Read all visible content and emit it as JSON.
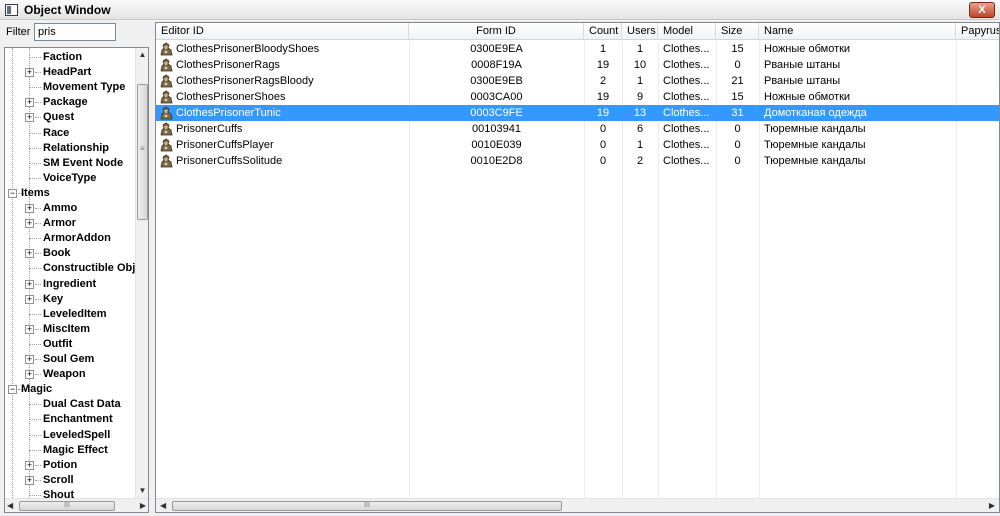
{
  "window": {
    "title": "Object Window",
    "close_label": "X"
  },
  "filter": {
    "label": "Filter",
    "value": "pris"
  },
  "tree": {
    "items": [
      {
        "label": "Faction",
        "expander": ""
      },
      {
        "label": "HeadPart",
        "expander": "+"
      },
      {
        "label": "Movement Type",
        "expander": ""
      },
      {
        "label": "Package",
        "expander": "+"
      },
      {
        "label": "Quest",
        "expander": "+"
      },
      {
        "label": "Race",
        "expander": ""
      },
      {
        "label": "Relationship",
        "expander": ""
      },
      {
        "label": "SM Event Node",
        "expander": ""
      },
      {
        "label": "VoiceType",
        "expander": ""
      },
      {
        "label": "Items",
        "expander": "−"
      },
      {
        "label": "Ammo",
        "expander": "+"
      },
      {
        "label": "Armor",
        "expander": "+"
      },
      {
        "label": "ArmorAddon",
        "expander": ""
      },
      {
        "label": "Book",
        "expander": "+"
      },
      {
        "label": "Constructible Obj",
        "expander": ""
      },
      {
        "label": "Ingredient",
        "expander": "+"
      },
      {
        "label": "Key",
        "expander": "+"
      },
      {
        "label": "LeveledItem",
        "expander": ""
      },
      {
        "label": "MiscItem",
        "expander": "+"
      },
      {
        "label": "Outfit",
        "expander": ""
      },
      {
        "label": "Soul Gem",
        "expander": "+"
      },
      {
        "label": "Weapon",
        "expander": "+"
      },
      {
        "label": "Magic",
        "expander": "−"
      },
      {
        "label": "Dual Cast Data",
        "expander": ""
      },
      {
        "label": "Enchantment",
        "expander": ""
      },
      {
        "label": "LeveledSpell",
        "expander": ""
      },
      {
        "label": "Magic Effect",
        "expander": ""
      },
      {
        "label": "Potion",
        "expander": "+"
      },
      {
        "label": "Scroll",
        "expander": "+"
      },
      {
        "label": "Shout",
        "expander": ""
      }
    ]
  },
  "list": {
    "columns": [
      "Editor ID",
      "Form ID",
      "Count",
      "Users",
      "Model",
      "Size",
      "Name",
      "Papyrus"
    ],
    "rows": [
      {
        "editor_id": "ClothesPrisonerBloodyShoes",
        "form_id": "0300E9EA",
        "count": "1",
        "users": "1",
        "model": "Clothes...",
        "size": "15",
        "name": "Ножные обмотки",
        "papyrus": ""
      },
      {
        "editor_id": "ClothesPrisonerRags",
        "form_id": "0008F19A",
        "count": "19",
        "users": "10",
        "model": "Clothes...",
        "size": "0",
        "name": "Рваные штаны",
        "papyrus": ""
      },
      {
        "editor_id": "ClothesPrisonerRagsBloody",
        "form_id": "0300E9EB",
        "count": "2",
        "users": "1",
        "model": "Clothes...",
        "size": "21",
        "name": "Рваные штаны",
        "papyrus": ""
      },
      {
        "editor_id": "ClothesPrisonerShoes",
        "form_id": "0003CA00",
        "count": "19",
        "users": "9",
        "model": "Clothes...",
        "size": "15",
        "name": "Ножные обмотки",
        "papyrus": ""
      },
      {
        "editor_id": "ClothesPrisonerTunic",
        "form_id": "0003C9FE",
        "count": "19",
        "users": "13",
        "model": "Clothes...",
        "size": "31",
        "name": "Домотканая одежда",
        "papyrus": ""
      },
      {
        "editor_id": "PrisonerCuffs",
        "form_id": "00103941",
        "count": "0",
        "users": "6",
        "model": "Clothes...",
        "size": "0",
        "name": "Тюремные кандалы",
        "papyrus": ""
      },
      {
        "editor_id": "PrisonerCuffsPlayer",
        "form_id": "0010E039",
        "count": "0",
        "users": "1",
        "model": "Clothes...",
        "size": "0",
        "name": "Тюремные кандалы",
        "papyrus": ""
      },
      {
        "editor_id": "PrisonerCuffsSolitude",
        "form_id": "0010E2D8",
        "count": "0",
        "users": "2",
        "model": "Clothes...",
        "size": "0",
        "name": "Тюремные кандалы",
        "papyrus": ""
      }
    ],
    "selected_row": 4
  },
  "scrollbar": {
    "grip": "≡",
    "hgrip": "III",
    "up": "▲",
    "down": "▼",
    "left": "◀",
    "right": "▶"
  },
  "colors": {
    "selection": "#3399ff",
    "title_bar": "#e3e3e3",
    "close_button": "#c0452a"
  },
  "icons": {
    "row": "armor-icon",
    "close": "close-icon",
    "app": "window-icon"
  }
}
